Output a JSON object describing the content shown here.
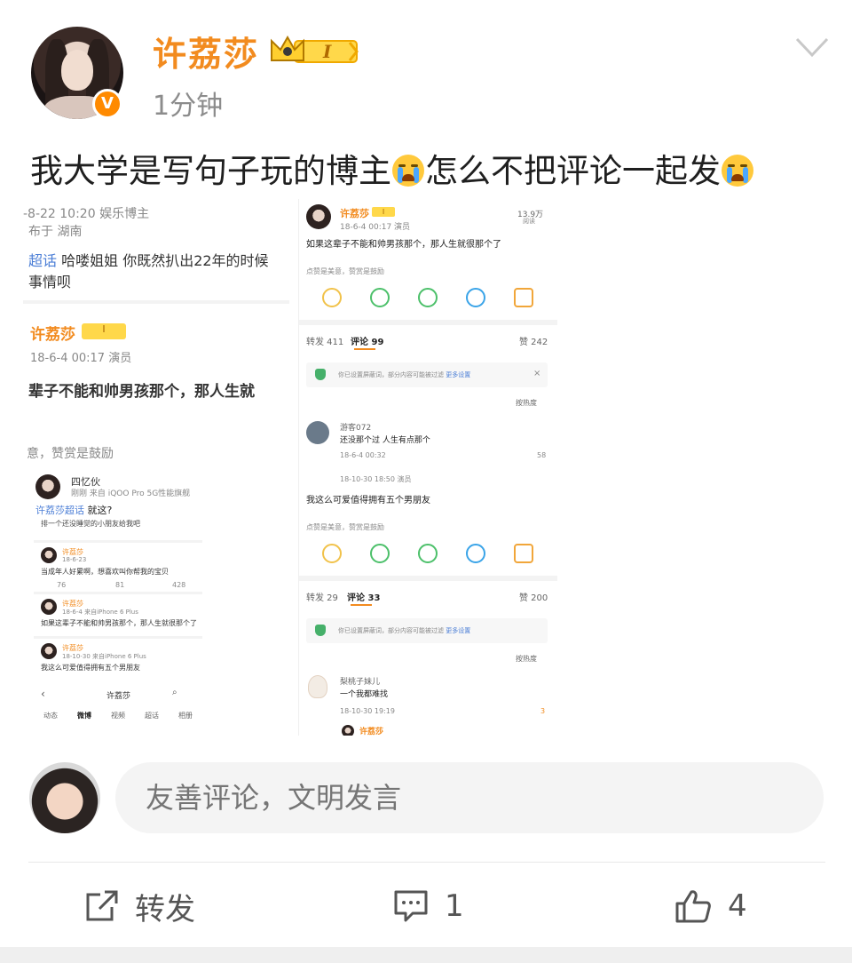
{
  "post": {
    "username": "许荔莎",
    "level_badge": "I",
    "time": "1分钟",
    "text_part1": "我大学是写句子玩的博主",
    "text_part2": "怎么不把评论一起发",
    "verified_icon": "V"
  },
  "left_shot": {
    "top_meta": "-8-22 10:20  娱乐博主",
    "location": "布于 湖南",
    "topic_link": "超话",
    "topic_text": " 哈喽姐姐 你既然扒出22年的时候",
    "topic_text2": "事情呗",
    "inner_name": "许荔莎",
    "inner_badge": "I",
    "inner_time": "18-6-4 00:17  演员",
    "inner_text": "辈子不能和帅男孩那个，那人生就",
    "inner_footer": "意，赞赏是鼓励",
    "nested": {
      "name": "四忆伙",
      "meta": "刚刚  来自 iQOO Pro 5G性能旗舰",
      "topic": "许荔莎超话",
      "topic_suffix": " 就这?",
      "line1": "排一个还没睡觉的小朋友给我吧",
      "c1_name": "许荔莎",
      "c1_date": "18-6-23",
      "c1_text": "当成年人好累啊，想喜欢叫你帮我的宝贝",
      "c1_stats": [
        "76",
        "81",
        "428"
      ],
      "c2_name": "许荔莎",
      "c2_date": "18-6-4  来自iPhone 6 Plus",
      "c2_text": "如果这辈子不能和帅男孩那个，那人生就很那个了",
      "c3_name": "许荔莎",
      "c3_date": "18-10-30  来自iPhone 6 Plus",
      "c3_text": "我这么可爱值得拥有五个男朋友",
      "nav_title": "许荔莎",
      "tabs": [
        "动态",
        "微博",
        "视频",
        "超话",
        "相册"
      ]
    }
  },
  "right_shot": {
    "name": "许荔莎",
    "badge": "I",
    "date": "18-6-4 00:17  演员",
    "views": "13.9万",
    "views_label": "阅读",
    "text": "如果这辈子不能和帅男孩那个，那人生就很那个了",
    "reward": "点赞是美意，赞赏是鼓励",
    "tabs1": {
      "repost": "转发 411",
      "comment": "评论 99",
      "like": "赞 242"
    },
    "notice": "你已设置屏蔽词，部分内容可能被过滤",
    "notice_link": "更多设置",
    "sort": "按热度",
    "comment1": {
      "name": "游客072",
      "text": "还没那个过 人生有点那个",
      "date": "18-6-4 00:32",
      "likes": "58"
    },
    "post2_date": "18-10-30 18:50  演员",
    "post2_text": "我这么可爱值得拥有五个男朋友",
    "reward2": "点赞是美意，赞赏是鼓励",
    "tabs2": {
      "repost": "转发 29",
      "comment": "评论 33",
      "like": "赞 200"
    },
    "notice2": "你已设置屏蔽词，部分内容可能被过滤",
    "notice2_link": "更多设置",
    "sort2": "按热度",
    "comment2": {
      "name": "梨桃子妹儿",
      "text": "一个我都难找",
      "date": "18-10-30 19:19",
      "likes": "3"
    },
    "footer_name": "许荔莎"
  },
  "comment_bar": {
    "placeholder": "友善评论，文明发言"
  },
  "actions": {
    "repost_label": "转发",
    "comment_count": "1",
    "like_count": "4"
  },
  "colors": {
    "brand_orange": "#f28b1f",
    "text_gray": "#8c8c8c",
    "input_bg": "#f4f4f4"
  },
  "icons": [
    "chevron-down-icon",
    "crown-icon",
    "verified-icon",
    "repost-icon",
    "comment-icon",
    "like-icon",
    "crying-emoji-icon"
  ]
}
